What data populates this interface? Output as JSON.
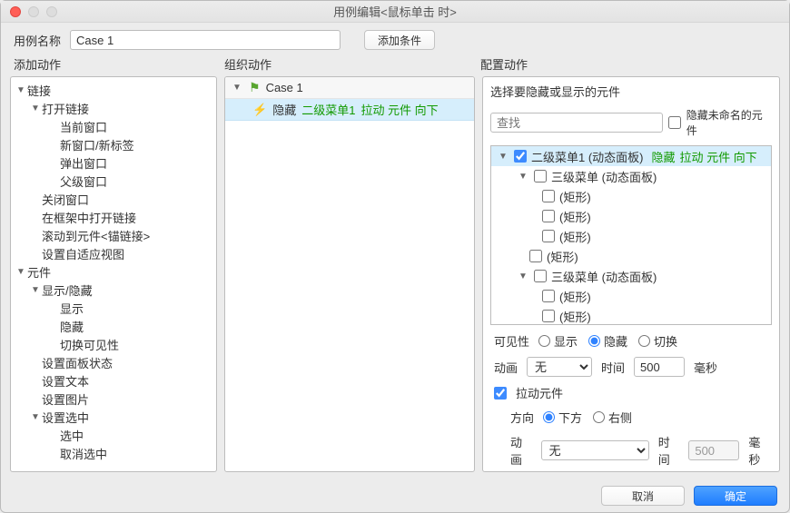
{
  "window": {
    "title": "用例编辑<鼠标单击 时>"
  },
  "top": {
    "name_label": "用例名称",
    "name_value": "Case 1",
    "add_condition": "添加条件"
  },
  "sections": {
    "left": "添加动作",
    "mid": "组织动作",
    "right": "配置动作"
  },
  "left_tree": {
    "g0": "链接",
    "g0_0": "打开链接",
    "g0_0_0": "当前窗口",
    "g0_0_1": "新窗口/新标签",
    "g0_0_2": "弹出窗口",
    "g0_0_3": "父级窗口",
    "g0_1": "关闭窗口",
    "g0_2": "在框架中打开链接",
    "g0_3": "滚动到元件<锚链接>",
    "g0_4": "设置自适应视图",
    "g1": "元件",
    "g1_0": "显示/隐藏",
    "g1_0_0": "显示",
    "g1_0_1": "隐藏",
    "g1_0_2": "切换可见性",
    "g1_1": "设置面板状态",
    "g1_2": "设置文本",
    "g1_3": "设置图片",
    "g1_4": "设置选中",
    "g1_4_0": "选中",
    "g1_4_1": "取消选中"
  },
  "mid": {
    "case": "Case 1",
    "event_row": {
      "prefix": "隐藏 ",
      "target": "二级菜单1 ",
      "opts": "拉动 元件 向下"
    }
  },
  "right": {
    "header": "选择要隐藏或显示的元件",
    "search_ph": "查找",
    "hide_unnamed": "隐藏未命名的元件",
    "tree": {
      "n0": "二级菜单1 (动态面板)",
      "n0_state_pre": "隐藏 ",
      "n0_state_opts": "拉动 元件 向下",
      "n1": "三级菜单 (动态面板)",
      "shape": "(矩形)"
    },
    "cfg": {
      "visibility_label": "可见性",
      "vis_show": "显示",
      "vis_hide": "隐藏",
      "vis_toggle": "切换",
      "anim_label": "动画",
      "anim_none": "无",
      "time_label": "时间",
      "time_value": "500",
      "ms": "毫秒",
      "pull_label": "拉动元件",
      "dir_label": "方向",
      "dir_down": "下方",
      "dir_right": "右侧"
    }
  },
  "footer": {
    "cancel": "取消",
    "ok": "确定"
  }
}
